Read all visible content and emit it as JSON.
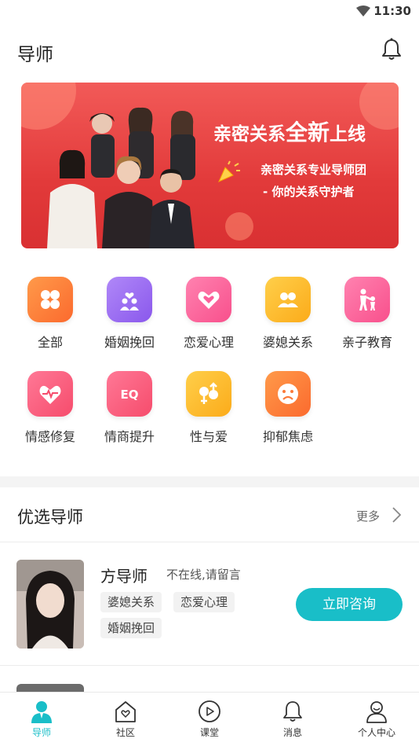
{
  "status_bar": {
    "time": "11:30"
  },
  "header": {
    "title": "导师"
  },
  "banner": {
    "headline_prefix": "亲密关系",
    "headline_big": "全新",
    "headline_suffix": "上线",
    "sub1": "亲密关系专业导师团",
    "sub2": "- 你的关系守护者"
  },
  "categories": [
    {
      "label": "全部",
      "icon": "grid-icon",
      "color": "#fb7a3a"
    },
    {
      "label": "婚姻挽回",
      "icon": "couple-icon",
      "color": "#9b6cf0"
    },
    {
      "label": "恋爱心理",
      "icon": "hearts-icon",
      "color": "#fb5f9a"
    },
    {
      "label": "婆媳关系",
      "icon": "people-icon",
      "color": "#fbb626"
    },
    {
      "label": "亲子教育",
      "icon": "parent-child-icon",
      "color": "#fb5f9a"
    },
    {
      "label": "情感修复",
      "icon": "heartbeat-icon",
      "color": "#fb5474"
    },
    {
      "label": "情商提升",
      "icon": "eq-icon",
      "color": "#fb5474"
    },
    {
      "label": "性与爱",
      "icon": "gender-icon",
      "color": "#fbb626"
    },
    {
      "label": "抑郁焦虑",
      "icon": "sad-face-icon",
      "color": "#fb7a3a"
    }
  ],
  "section": {
    "title": "优选导师",
    "more": "更多"
  },
  "mentor": {
    "name": "方导师",
    "status": "不在线,请留言",
    "tags": [
      "婆媳关系",
      "恋爱心理",
      "婚姻挽回"
    ],
    "consult": "立即咨询"
  },
  "tabs": [
    {
      "label": "导师",
      "icon": "mentor-icon",
      "active": true
    },
    {
      "label": "社区",
      "icon": "home-heart-icon",
      "active": false
    },
    {
      "label": "课堂",
      "icon": "play-icon",
      "active": false
    },
    {
      "label": "消息",
      "icon": "bell-icon",
      "active": false
    },
    {
      "label": "个人中心",
      "icon": "user-icon",
      "active": false
    }
  ],
  "colors": {
    "accent": "#19bec8",
    "banner": "#e53c3c"
  }
}
